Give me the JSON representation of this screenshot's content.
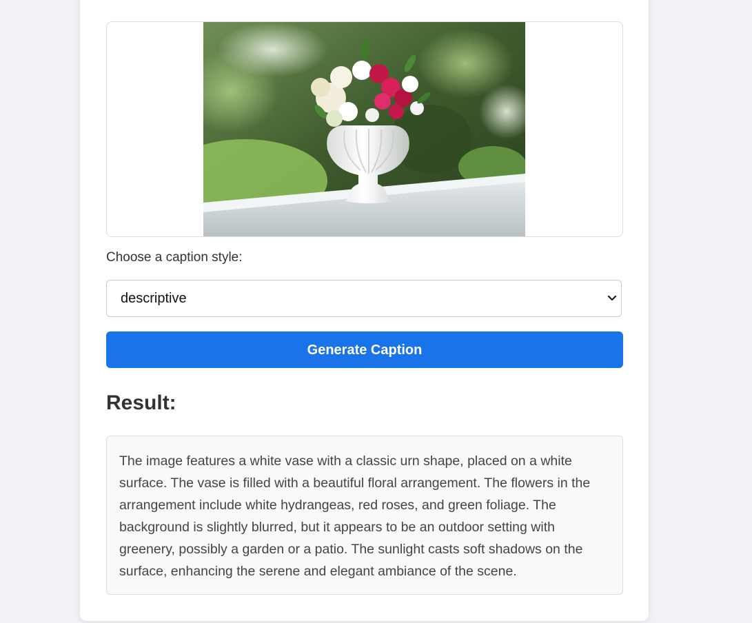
{
  "preview": {
    "image_icon": "photo-vase-flowers"
  },
  "form": {
    "style_label": "Choose a caption style:",
    "style_select": {
      "selected": "descriptive",
      "icon": "chevron-down-icon"
    },
    "generate_label": "Generate Caption"
  },
  "result": {
    "heading": "Result:",
    "text": "The image features a white vase with a classic urn shape, placed on a white surface. The vase is filled with a beautiful floral arrangement. The flowers in the arrangement include white hydrangeas, red roses, and green foliage. The background is slightly blurred, but it appears to be an outdoor setting with greenery, possibly a garden or a patio. The sunlight casts soft shadows on the surface, enhancing the serene and elegant ambiance of the scene."
  },
  "colors": {
    "page_bg": "#f0f2f5",
    "accent": "#1a73e8",
    "result_bg": "#f8f9fa"
  }
}
